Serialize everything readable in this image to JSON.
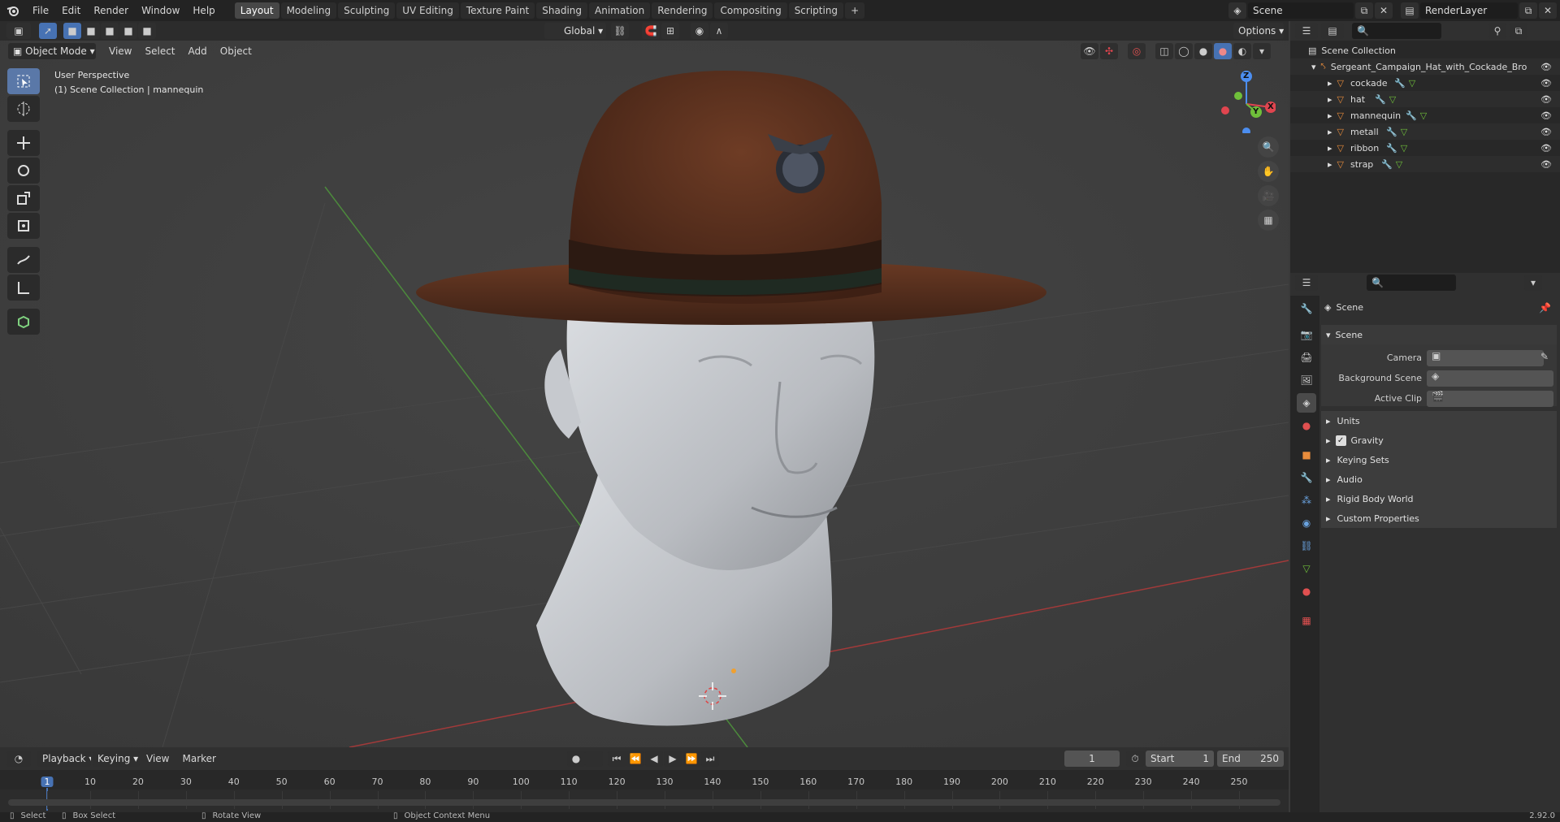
{
  "topbar": {
    "menus": [
      "File",
      "Edit",
      "Render",
      "Window",
      "Help"
    ],
    "tabs": [
      "Layout",
      "Modeling",
      "Sculpting",
      "UV Editing",
      "Texture Paint",
      "Shading",
      "Animation",
      "Rendering",
      "Compositing",
      "Scripting"
    ],
    "active_tab": "Layout",
    "scene": "Scene",
    "view_layer": "RenderLayer"
  },
  "header": {
    "mode": "Object Mode",
    "menus": [
      "View",
      "Select",
      "Add",
      "Object"
    ],
    "transform_orientation": "Global",
    "options": "Options"
  },
  "viewport": {
    "info_line1": "User Perspective",
    "info_line2": "(1) Scene Collection | mannequin",
    "gizmo": {
      "x": "X",
      "y": "Y",
      "z": "Z"
    }
  },
  "outliner": {
    "root": "Scene Collection",
    "collection": "Sergeant_Campaign_Hat_with_Cockade_Bro",
    "items": [
      "cockade",
      "hat",
      "mannequin",
      "metall",
      "ribbon",
      "strap"
    ]
  },
  "properties": {
    "header": "Scene",
    "section": "Scene",
    "fields": [
      "Camera",
      "Background Scene",
      "Active Clip"
    ],
    "panels": [
      "Units",
      "Gravity",
      "Keying Sets",
      "Audio",
      "Rigid Body World",
      "Custom Properties"
    ],
    "gravity_checked": true
  },
  "timeline": {
    "menus": [
      "Playback",
      "Keying",
      "View",
      "Marker"
    ],
    "current_frame": "1",
    "start_label": "Start",
    "start": "1",
    "end_label": "End",
    "end": "250",
    "ticks": [
      "1",
      "10",
      "20",
      "30",
      "40",
      "50",
      "60",
      "70",
      "80",
      "90",
      "100",
      "110",
      "120",
      "130",
      "140",
      "150",
      "160",
      "170",
      "180",
      "190",
      "200",
      "210",
      "220",
      "230",
      "240",
      "250"
    ]
  },
  "statusbar": {
    "select": "Select",
    "box_select": "Box Select",
    "rotate_view": "Rotate View",
    "context_menu": "Object Context Menu",
    "version": "2.92.0"
  },
  "colors": {
    "accent": "#4772b3",
    "x_axis": "#e0454f",
    "y_axis": "#6fbf3a",
    "z_axis": "#4c8ef0",
    "mesh_icon": "#e88c3c"
  }
}
